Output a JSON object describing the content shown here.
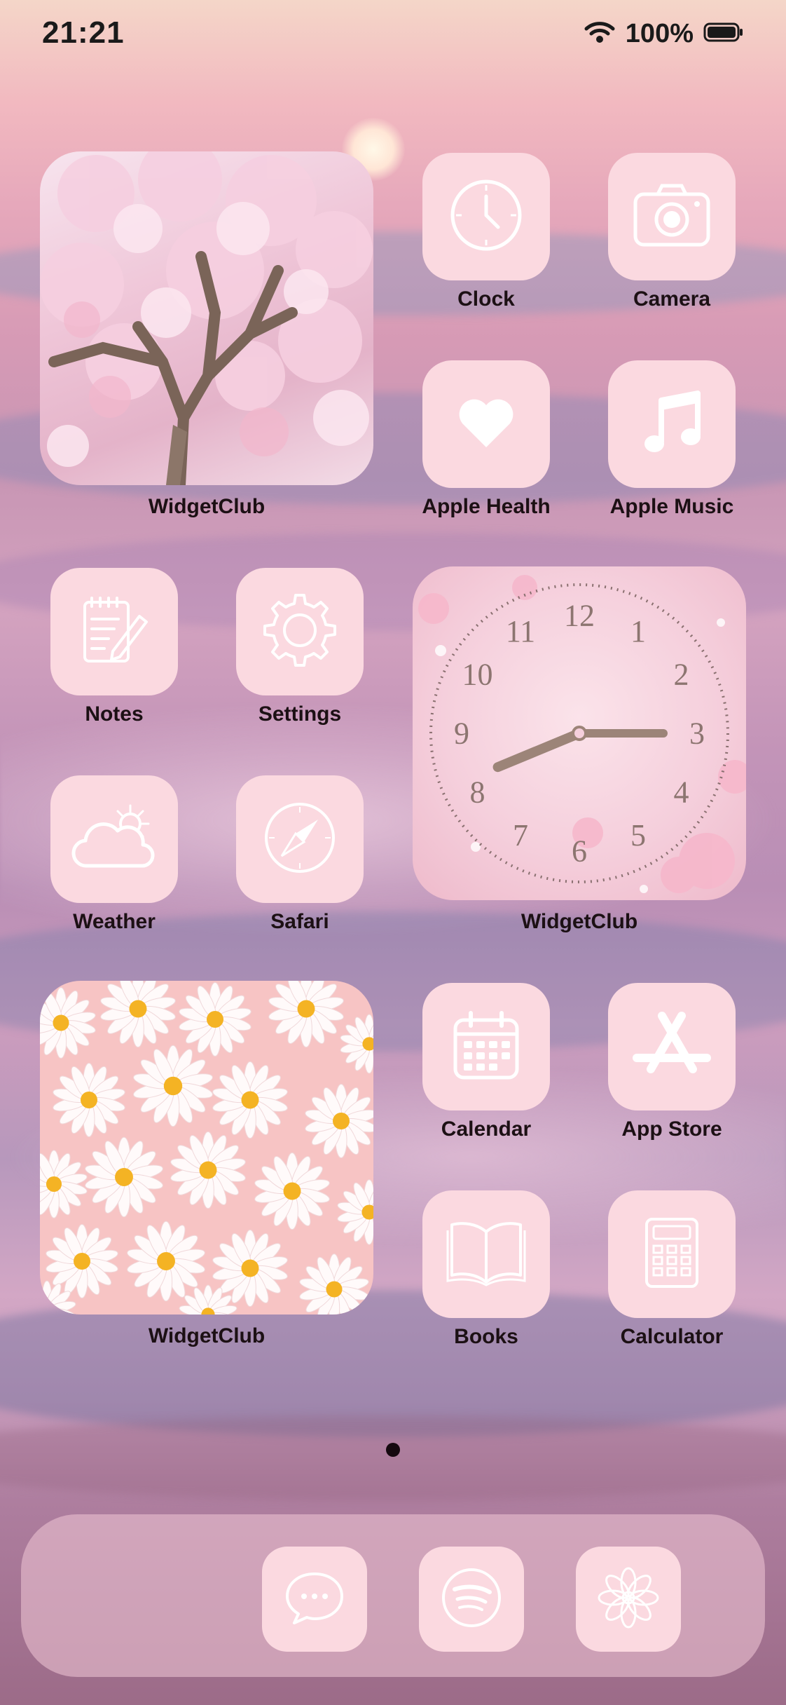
{
  "status_bar": {
    "time": "21:21",
    "battery_percent": "100%",
    "wifi_icon": "wifi-icon",
    "battery_icon": "battery-icon"
  },
  "apps": {
    "clock": {
      "label": "Clock",
      "icon": "clock-icon"
    },
    "camera": {
      "label": "Camera",
      "icon": "camera-icon"
    },
    "health": {
      "label": "Apple Health",
      "icon": "heart-icon"
    },
    "music": {
      "label": "Apple Music",
      "icon": "music-note-icon"
    },
    "notes": {
      "label": "Notes",
      "icon": "notepad-pencil-icon"
    },
    "settings": {
      "label": "Settings",
      "icon": "gear-icon"
    },
    "weather": {
      "label": "Weather",
      "icon": "cloud-sun-icon"
    },
    "safari": {
      "label": "Safari",
      "icon": "compass-icon"
    },
    "calendar": {
      "label": "Calendar",
      "icon": "calendar-icon"
    },
    "appstore": {
      "label": "App Store",
      "icon": "app-store-icon"
    },
    "books": {
      "label": "Books",
      "icon": "open-book-icon"
    },
    "calculator": {
      "label": "Calculator",
      "icon": "calculator-icon"
    }
  },
  "widgets": {
    "photo_tree": {
      "label": "WidgetClub",
      "image": "cherry-blossom-tree-photo"
    },
    "analog_clock": {
      "label": "WidgetClub",
      "hour": 8,
      "minute": 15,
      "numerals": [
        "12",
        "1",
        "2",
        "3",
        "4",
        "5",
        "6",
        "7",
        "8",
        "9",
        "10",
        "11"
      ]
    },
    "photo_daisies": {
      "label": "WidgetClub",
      "image": "white-daisies-photo"
    }
  },
  "dock": {
    "apps": [
      {
        "icon": "speech-bubble-icon"
      },
      {
        "icon": "spotify-icon"
      },
      {
        "icon": "flower-icon"
      }
    ]
  },
  "page_indicator": {
    "pages": 1,
    "current": 1
  },
  "colors": {
    "icon_tile": "#fbd9e0",
    "icon_glyph": "#ffffff",
    "label": "#1c1014",
    "clock_hands": "#9c8478"
  }
}
